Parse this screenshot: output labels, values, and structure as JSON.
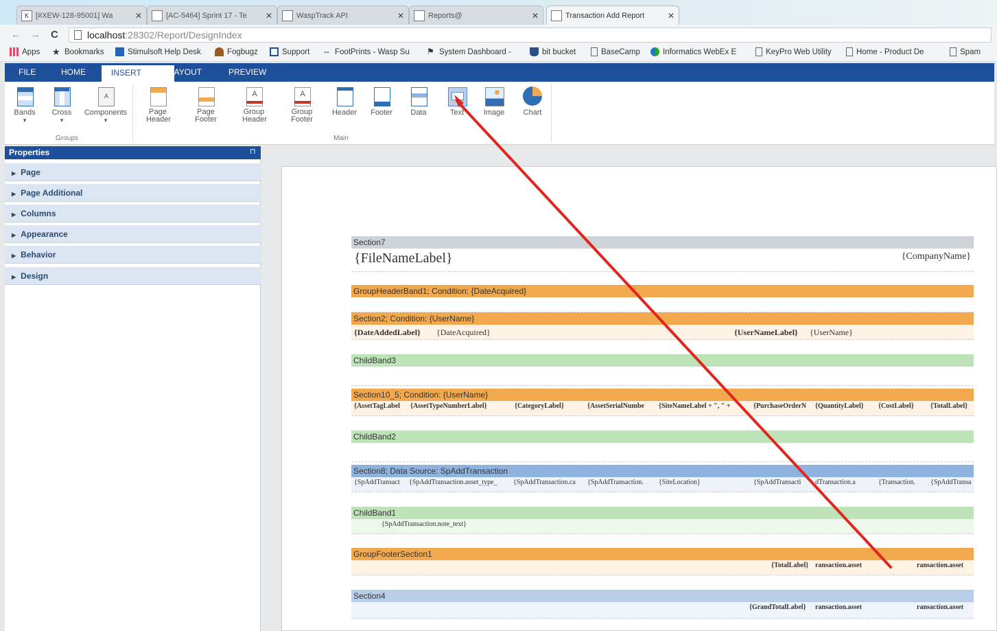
{
  "browser": {
    "tabs": [
      {
        "title": "[#XEW-128-95001] Wa"
      },
      {
        "title": "[AC-5464] Sprint 17 - Te"
      },
      {
        "title": "WaspTrack API"
      },
      {
        "title": "Reports@"
      },
      {
        "title": "Transaction Add Report"
      }
    ],
    "address": {
      "host": "localhost",
      "path": ":28302/Report/DesignIndex"
    },
    "bookmarks": [
      "Apps",
      "Bookmarks",
      "Stimulsoft Help Desk",
      "Fogbugz",
      "Support",
      "FootPrints - Wasp Su",
      "System Dashboard -",
      "bit bucket",
      "BaseCamp",
      "Informatics WebEx E",
      "KeyPro Web Utility",
      "Home - Product De",
      "Spam"
    ]
  },
  "ribbon": {
    "menus": [
      "FILE",
      "HOME",
      "INSERT",
      "LAYOUT",
      "PREVIEW"
    ],
    "active_menu": "INSERT",
    "groups_label": "Groups",
    "main_label": "Main",
    "buttons": {
      "bands": "Bands",
      "cross": "Cross",
      "components": "Components",
      "page_header": "Page Header",
      "page_footer": "Page Footer",
      "group_header": "Group Header",
      "group_footer": "Group Footer",
      "header": "Header",
      "footer": "Footer",
      "data": "Data",
      "text": "Text",
      "image": "Image",
      "chart": "Chart"
    }
  },
  "properties": {
    "title": "Properties",
    "pin": "p",
    "items": [
      "Page",
      "Page Additional",
      "Columns",
      "Appearance",
      "Behavior",
      "Design"
    ]
  },
  "report": {
    "section7": {
      "label": "Section7",
      "left": "{FileNameLabel}",
      "right": "{CompanyName}"
    },
    "group_header": {
      "label": "GroupHeaderBand1; Condition: {DateAcquired}"
    },
    "section2": {
      "label": "Section2; Condition: {UserName}",
      "c1": "{DateAddedLabel}",
      "c2": "{DateAcquired}",
      "c3": "{UserNameLabel}",
      "c4": "{UserName}"
    },
    "childband3": {
      "label": "ChildBand3"
    },
    "section10": {
      "label": "Section10_5; Condition: {UserName}",
      "cells": [
        "{AssetTagLabel",
        "{AssetTypeNumberLabel}",
        "{CategoryLabel}",
        "{AssetSerialNumbe",
        "{SiteNameLabel + \", \" +",
        "{PurchaseOrderN",
        "{QuantityLabel}",
        "{CostLabel}",
        "{TotalLabel}"
      ]
    },
    "childband2": {
      "label": "ChildBand2"
    },
    "section8": {
      "label": "Section8; Data Source: SpAddTransaction",
      "cells": [
        "{SpAddTransact",
        "{SpAddTransaction.asset_type_",
        "{SpAddTransaction.ca",
        "{SpAddTransaction.",
        "{SiteLocation}",
        "{SpAddTransacti",
        "dTransaction.a",
        "{Transaction.",
        "{SpAddTransact"
      ]
    },
    "childband1": {
      "label": "ChildBand1",
      "cell": "{SpAddTransaction.note_text}"
    },
    "group_footer": {
      "label": "GroupFooterSection1",
      "c1": "{TotalLabel}",
      "c2": "ransaction.asset",
      "c3": "ransaction.asset"
    },
    "section4": {
      "label": "Section4",
      "c1": "{GrandTotalLabel}",
      "c2": "ransaction.asset",
      "c3": "ransaction.asset"
    }
  },
  "colors": {
    "ribbon_blue": "#1e4f9a",
    "band_orange": "#f2a94e",
    "band_green": "#bfe3b9",
    "band_blue": "#8fb3df",
    "arrow_red": "#e0261e"
  }
}
